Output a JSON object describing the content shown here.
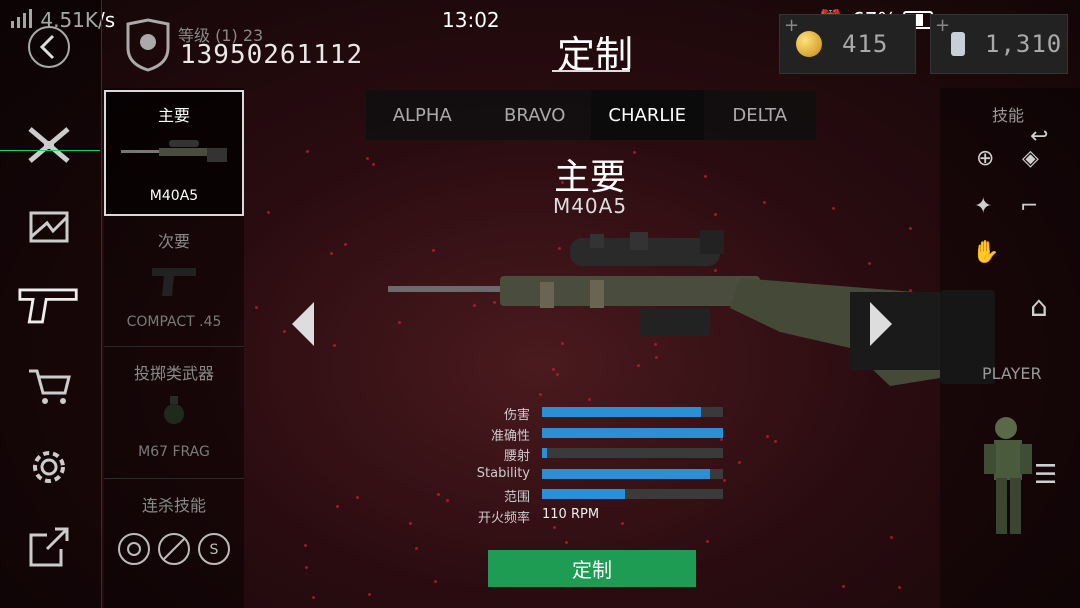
{
  "status_bar": {
    "net_speed": "4.51K/s",
    "time": "13:02",
    "battery": "67%"
  },
  "player": {
    "level": "等级 (1) 23",
    "id": "13950261112"
  },
  "header": {
    "title": "定制"
  },
  "currency": {
    "gold": "415",
    "silver": "1,310"
  },
  "tabs": [
    {
      "label": "ALPHA"
    },
    {
      "label": "BRAVO"
    },
    {
      "label": "CHARLIE"
    },
    {
      "label": "DELTA"
    }
  ],
  "weapon": {
    "slot_title": "主要",
    "name": "M40A5"
  },
  "slots": [
    {
      "label": "主要",
      "item": "M40A5"
    },
    {
      "label": "次要",
      "item": "COMPACT .45"
    },
    {
      "label": "投掷类武器",
      "item": "M67 FRAG"
    },
    {
      "label": "连杀技能"
    }
  ],
  "stats": [
    {
      "label": "伤害",
      "value": 0.88
    },
    {
      "label": "准确性",
      "value": 1.0
    },
    {
      "label": "腰射",
      "value": 0.03
    },
    {
      "label": "Stability",
      "value": 0.93
    },
    {
      "label": "范围",
      "value": 0.46
    }
  ],
  "fire_rate": {
    "label": "开火频率",
    "value": "110 RPM"
  },
  "customize_button": "定制",
  "right_panel": {
    "skills_label": "技能",
    "player_label": "PLAYER"
  },
  "colors": {
    "accent": "#2b8fd6",
    "button": "#1f9c53"
  }
}
